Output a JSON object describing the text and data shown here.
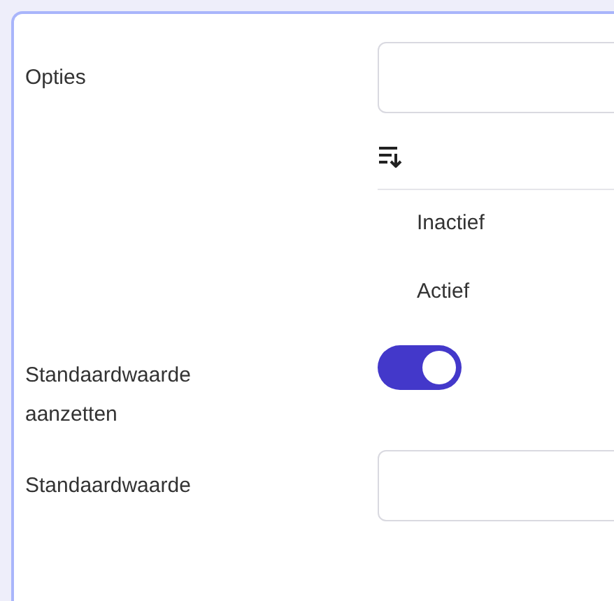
{
  "fields": [
    {
      "kind": "options",
      "label": "Opties",
      "options": [
        {
          "label": "Inactief"
        },
        {
          "label": "Actief"
        }
      ]
    },
    {
      "kind": "toggle",
      "label": "Standaardwaarde aanzetten",
      "on": true
    },
    {
      "kind": "text",
      "label": "Standaardwaarde"
    }
  ]
}
